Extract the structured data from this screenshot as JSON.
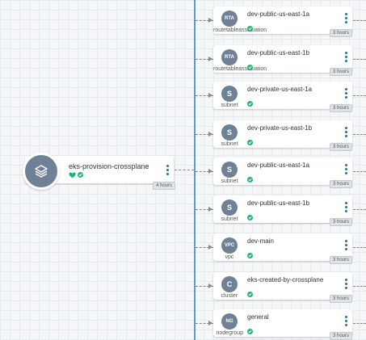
{
  "colors": {
    "accent": "#1a73a7",
    "icon_bg": "#6e8196",
    "healthy": "#21b573",
    "connector": "#5b9bd5"
  },
  "root": {
    "name": "eks-provision-crossplane",
    "icon": "layers-icon",
    "status_icons": [
      "heart-icon",
      "check-icon"
    ],
    "age": "4 hours"
  },
  "resources": [
    {
      "icon_text": "RTA",
      "kind": "routetableassociation",
      "name": "dev-public-us-east-1a",
      "age": "3 hours"
    },
    {
      "icon_text": "RTA",
      "kind": "routetableassociation",
      "name": "dev-public-us-east-1b",
      "age": "3 hours"
    },
    {
      "icon_text": "S",
      "kind": "subnet",
      "name": "dev-private-us-east-1a",
      "age": "3 hours"
    },
    {
      "icon_text": "S",
      "kind": "subnet",
      "name": "dev-private-us-east-1b",
      "age": "3 hours"
    },
    {
      "icon_text": "S",
      "kind": "subnet",
      "name": "dev-public-us-east-1a",
      "age": "3 hours"
    },
    {
      "icon_text": "S",
      "kind": "subnet",
      "name": "dev-public-us-east-1b",
      "age": "3 hours"
    },
    {
      "icon_text": "VPC",
      "kind": "vpc",
      "name": "dev-main",
      "age": "3 hours"
    },
    {
      "icon_text": "C",
      "kind": "cluster",
      "name": "eks-created-by-crossplane",
      "age": "3 hours"
    },
    {
      "icon_text": "NG",
      "kind": "nodegroup",
      "name": "general",
      "age": "3 hours"
    }
  ]
}
